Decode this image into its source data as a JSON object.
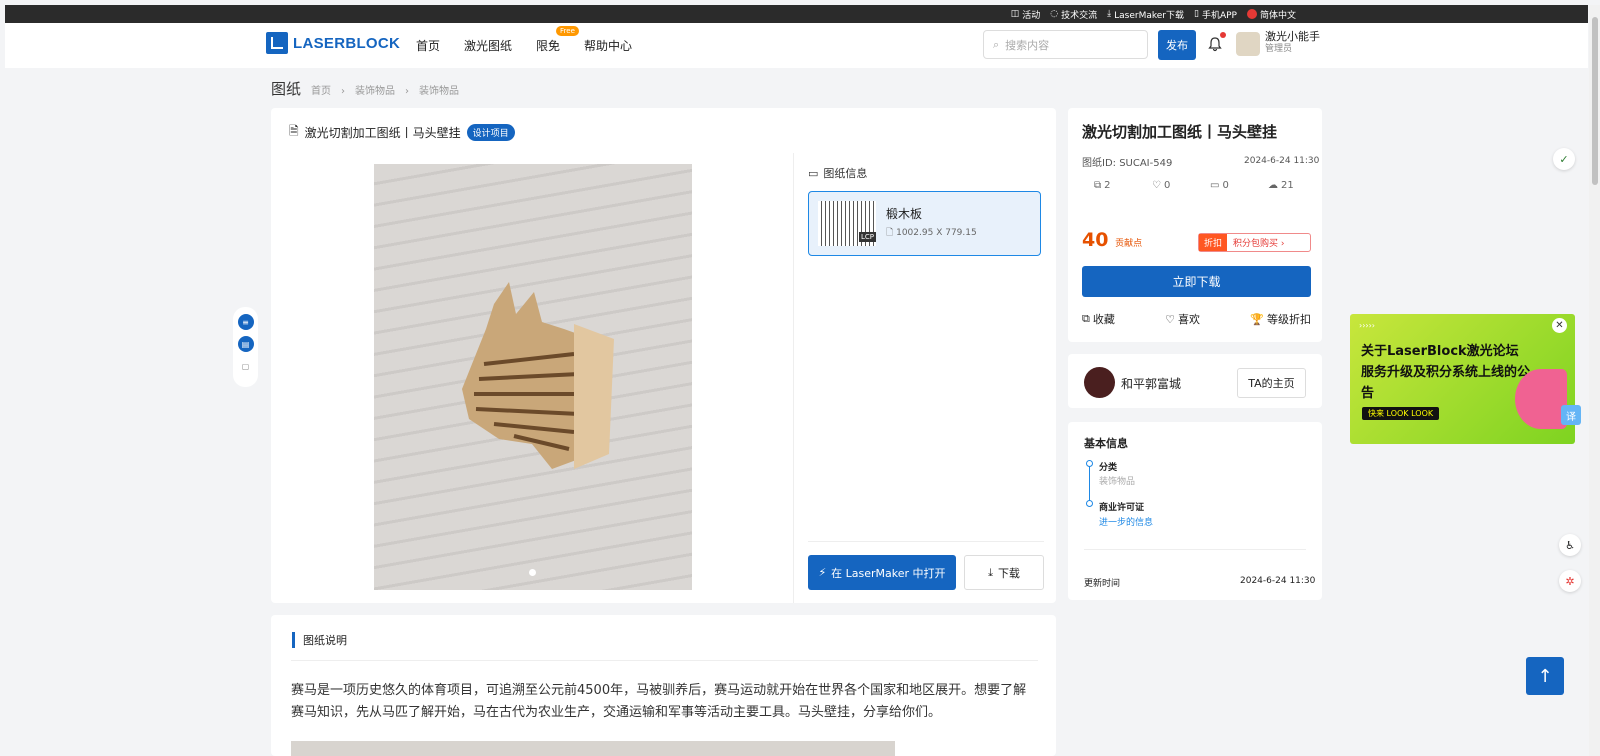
{
  "topbar": {
    "items": [
      "活动",
      "技术交流",
      "LaserMaker下载",
      "手机APP",
      "简体中文"
    ]
  },
  "nav": {
    "logo": "LASERBLOCK",
    "links": [
      "首页",
      "激光图纸",
      "限免",
      "帮助中心"
    ],
    "free_badge": "Free",
    "search_placeholder": "搜索内容",
    "publish": "发布",
    "user_name": "激光小能手",
    "user_role": "管理员"
  },
  "breadcrumb": {
    "section": "图纸",
    "path": [
      "首页",
      "装饰物品",
      "装饰物品"
    ],
    "sep": "›"
  },
  "side_nav_icons": [
    "list-icon",
    "doc-icon",
    "file-icon"
  ],
  "main": {
    "title": "激光切割加工图纸丨马头壁挂",
    "tag": "设计项目",
    "info_head": "图纸信息",
    "file": {
      "name": "椴木板",
      "size": "1002.95 X 779.15",
      "badge": "LCP"
    },
    "open_button": "在 LaserMaker 中打开",
    "download_button": "下载"
  },
  "right": {
    "title": "激光切割加工图纸丨马头壁挂",
    "id": "图纸ID: SUCAI-549",
    "date": "2024-6-24 11:30",
    "stats": [
      "2",
      "0",
      "0",
      "21"
    ],
    "price": "40",
    "price_unit": "贡献点",
    "promo_label": "折扣",
    "promo_text": "积分包购买 ›",
    "download_now": "立即下载",
    "actions": [
      "收藏",
      "喜欢",
      "等级折扣"
    ],
    "author": "和平郭富城",
    "author_home": "TA的主页",
    "basic_title": "基本信息",
    "category_k": "分类",
    "category_v": "装饰物品",
    "license_k": "商业许可证",
    "license_v": "进一步的信息",
    "update_k": "更新时间",
    "update_v": "2024-6-24 11:30"
  },
  "description": {
    "head": "图纸说明",
    "text": "赛马是一项历史悠久的体育项目，可追溯至公元前4500年，马被驯养后，赛马运动就开始在世界各个国家和地区展开。想要了解赛马知识，先从马匹了解开始，马在古代为农业生产，交通运输和军事等活动主要工具。马头壁挂，分享给你们。"
  },
  "ad": {
    "arrows": "›››››",
    "title": "关于LaserBlock激光论坛服务升级及积分系统上线的公告",
    "pill": "快来 LOOK LOOK",
    "translate": "译"
  },
  "colors": {
    "primary": "#1565c0",
    "accent": "#e65100"
  }
}
